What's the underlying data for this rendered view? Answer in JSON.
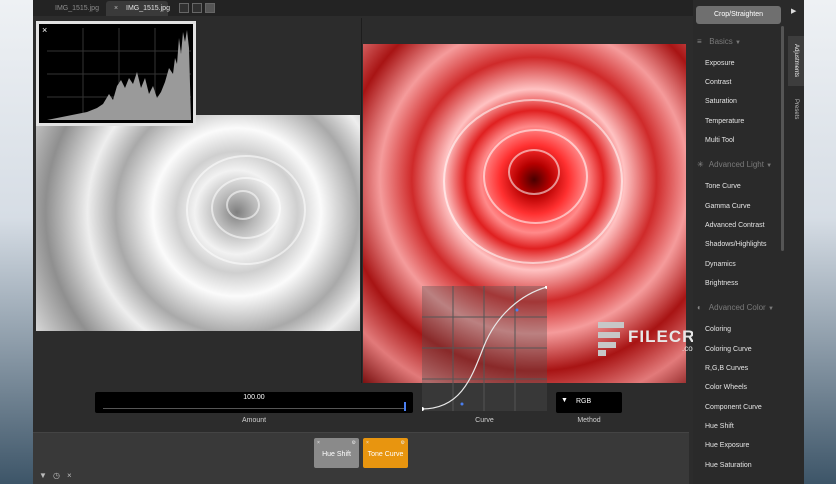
{
  "tabs": [
    {
      "label": "IMG_1515.jpg",
      "active": false
    },
    {
      "label": "IMG_1515.jpg",
      "active": true
    }
  ],
  "tab_close_icon": "×",
  "histogram": {
    "close_icon": "×"
  },
  "controls": {
    "amount_value": "100.00",
    "amount_level": 1.0,
    "amount_label": "Amount",
    "curve_label": "Curve",
    "method_label": "Method",
    "method_value": "RGB",
    "method_arrow": "▼"
  },
  "layers": [
    {
      "label": "Hue Shift",
      "color": "#8a8a8a"
    },
    {
      "label": "Tone Curve",
      "color": "#e8950f"
    }
  ],
  "footer_icons": [
    "▼",
    "◷",
    "×"
  ],
  "sidebar": {
    "crop_button": "Crop/Straighten",
    "sections": [
      {
        "title": "Basics",
        "icon": "≡",
        "items": [
          "Exposure",
          "Contrast",
          "Saturation",
          "Temperature",
          "Multi Tool"
        ]
      },
      {
        "title": "Advanced Light",
        "icon": "✳",
        "items": [
          "Tone Curve",
          "Gamma Curve",
          "Advanced Contrast",
          "Shadows/Highlights",
          "Dynamics",
          "Brightness"
        ]
      },
      {
        "title": "Advanced Color",
        "icon": "◐",
        "items": [
          "Coloring",
          "Coloring Curve",
          "R,G,B Curves",
          "Color Wheels",
          "Component Curve",
          "Hue Shift",
          "Hue Exposure",
          "Hue Saturation"
        ]
      }
    ],
    "section_chevron": "▼"
  },
  "right_tabs": {
    "arrow": "▶",
    "adjustments": "Adjustments",
    "presets": "Presets"
  },
  "watermark": {
    "brand": "FILECR",
    "suffix": ".com"
  }
}
